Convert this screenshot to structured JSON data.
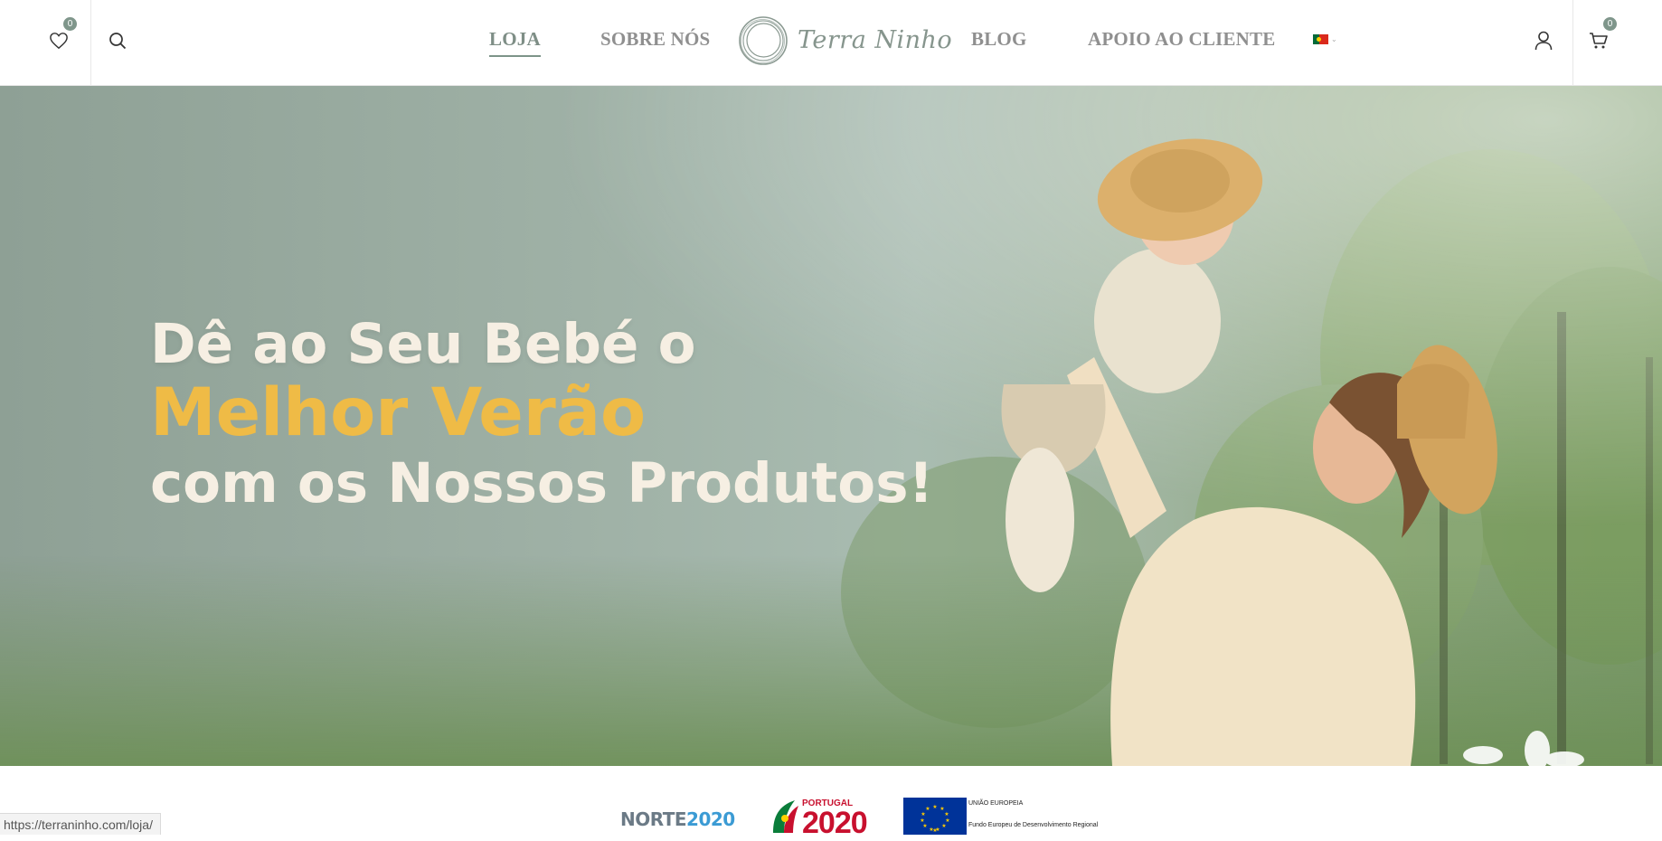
{
  "header": {
    "wishlist": {
      "icon": "heart-icon",
      "count": "0"
    },
    "search": {
      "icon": "search-icon"
    },
    "nav": [
      {
        "label": "LOJA",
        "active": true
      },
      {
        "label": "SOBRE NÓS",
        "active": false
      },
      {
        "label": "BLOG",
        "active": false
      },
      {
        "label": "APOIO AO CLIENTE",
        "active": false
      }
    ],
    "logo": {
      "text": "Terra Ninho",
      "icon": "circle-logo-icon"
    },
    "language": {
      "icon": "portugal-flag-icon",
      "caret": "chevron-down-icon"
    },
    "account": {
      "icon": "user-icon"
    },
    "cart": {
      "icon": "cart-icon",
      "count": "0"
    }
  },
  "hero": {
    "line1": "Dê ao Seu Bebé o",
    "line2": "Melhor Verão",
    "line3": "com os Nossos Produtos!",
    "colors": {
      "text": "#f6efe3",
      "highlight": "#efbb46",
      "background": "#9fb1a6"
    }
  },
  "footer_logos": {
    "norte": {
      "text_a": "NORTE",
      "text_b": "2020"
    },
    "portugal": {
      "label": "PORTUGAL",
      "year": "2020"
    },
    "eu": {
      "title": "UNIÃO EUROPEIA",
      "subtitle": "Fundo Europeu de Desenvolvimento Regional"
    }
  },
  "status_bar": {
    "url": "https://terraninho.com/loja/"
  }
}
